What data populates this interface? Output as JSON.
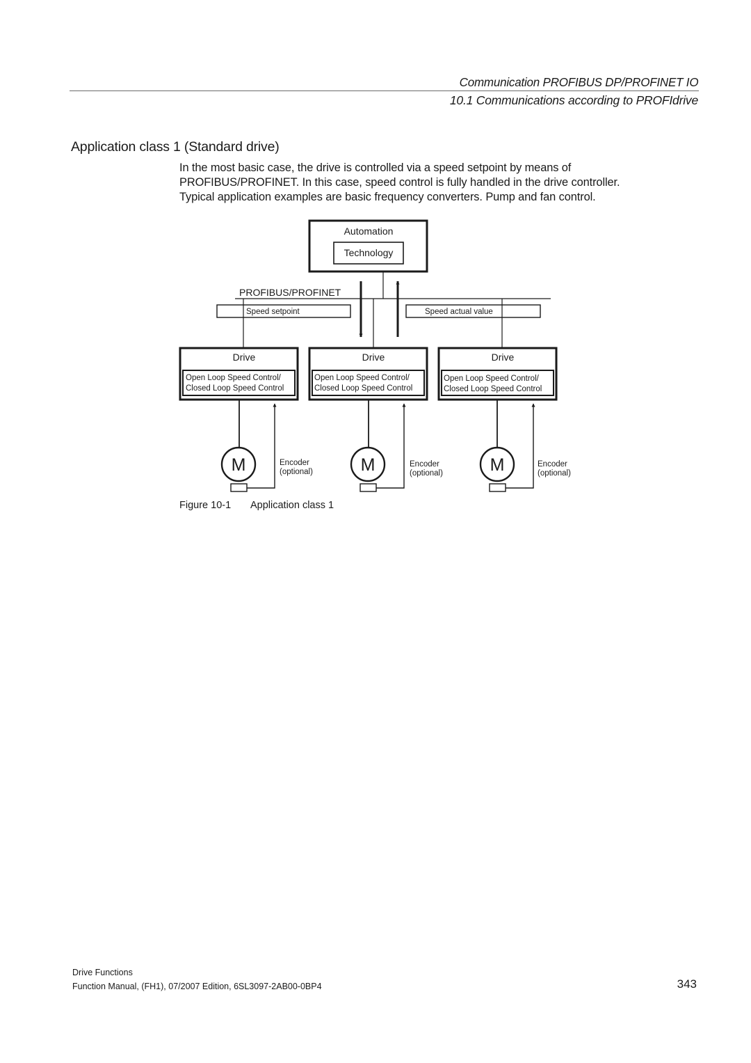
{
  "header": {
    "chapter": "Communication PROFIBUS DP/PROFINET IO",
    "section": "10.1 Communications according to PROFIdrive"
  },
  "section_title": "Application class 1 (Standard drive)",
  "paragraph_lines": [
    "In the most basic case, the drive is controlled via a speed setpoint by means of",
    "PROFIBUS/PROFINET. In this case, speed control is fully handled in the drive controller.",
    "Typical application examples are basic frequency converters. Pump and fan control."
  ],
  "diagram": {
    "automation_label": "Automation",
    "technology_label": "Technology",
    "bus_label": "PROFIBUS/PROFINET",
    "setpoint_label": "Speed setpoint",
    "actual_value_label": "Speed actual value",
    "drives": [
      {
        "title": "Drive",
        "control_line1": "Open Loop Speed Control/",
        "control_line2": "Closed Loop Speed Control",
        "motor": "M",
        "encoder_line1": "Encoder",
        "encoder_line2": "(optional)"
      },
      {
        "title": "Drive",
        "control_line1": "Open Loop Speed Control/",
        "control_line2": "Closed Loop Speed Control",
        "motor": "M",
        "encoder_line1": "Encoder",
        "encoder_line2": "(optional)"
      },
      {
        "title": "Drive",
        "control_line1": "Open Loop Speed Control/",
        "control_line2": "Closed Loop Speed Control",
        "motor": "M",
        "encoder_line1": "Encoder",
        "encoder_line2": "(optional)"
      }
    ]
  },
  "figure": {
    "number": "Figure 10-1",
    "caption": "Application class 1"
  },
  "footer": {
    "book": "Drive Functions",
    "edition": "Function Manual, (FH1), 07/2007 Edition, 6SL3097-2AB00-0BP4",
    "page": "343"
  }
}
